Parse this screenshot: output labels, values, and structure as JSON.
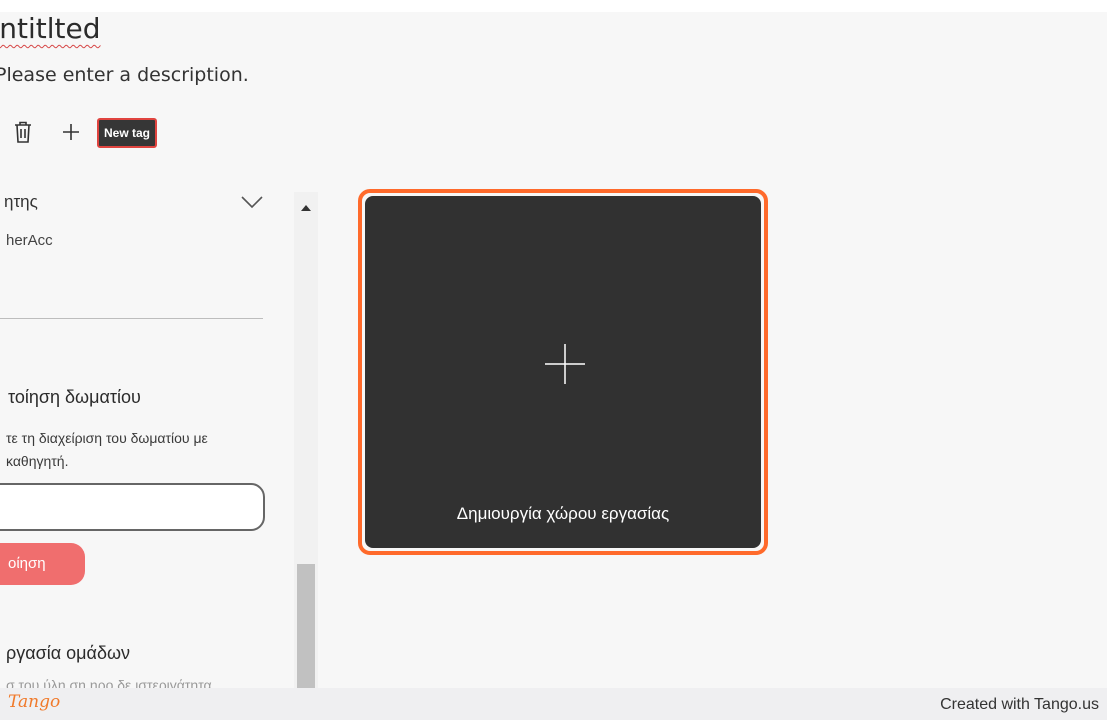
{
  "document": {
    "title": "Jntitlted",
    "description": "Please enter a description."
  },
  "tags": {
    "trash_icon": "trash-icon",
    "add_icon": "plus-icon",
    "new_tag_label": "New tag"
  },
  "settings": {
    "role_label": "ητης",
    "role_value": "herAcc",
    "share_title": "τοίηση δωματίου",
    "share_help": "τε τη διαχείριση του δωματίου με καθηγητή.",
    "share_input_value": "",
    "share_button_label": "οίηση",
    "group_title": "ργασία ομάδων",
    "group_help": "σ του ύλη ση ηρο δε ιστεριγάτητα"
  },
  "workspace_card": {
    "label": "Δημιουργία χώρου εργασίας",
    "icon": "plus-icon"
  },
  "footer": {
    "logo_text": "Tango",
    "created_with": "Created with Tango.us"
  },
  "colors": {
    "accent": "#ff6a2b",
    "tag_border": "#e0443f",
    "share_button": "#f06e6e",
    "card_bg": "#313131"
  }
}
